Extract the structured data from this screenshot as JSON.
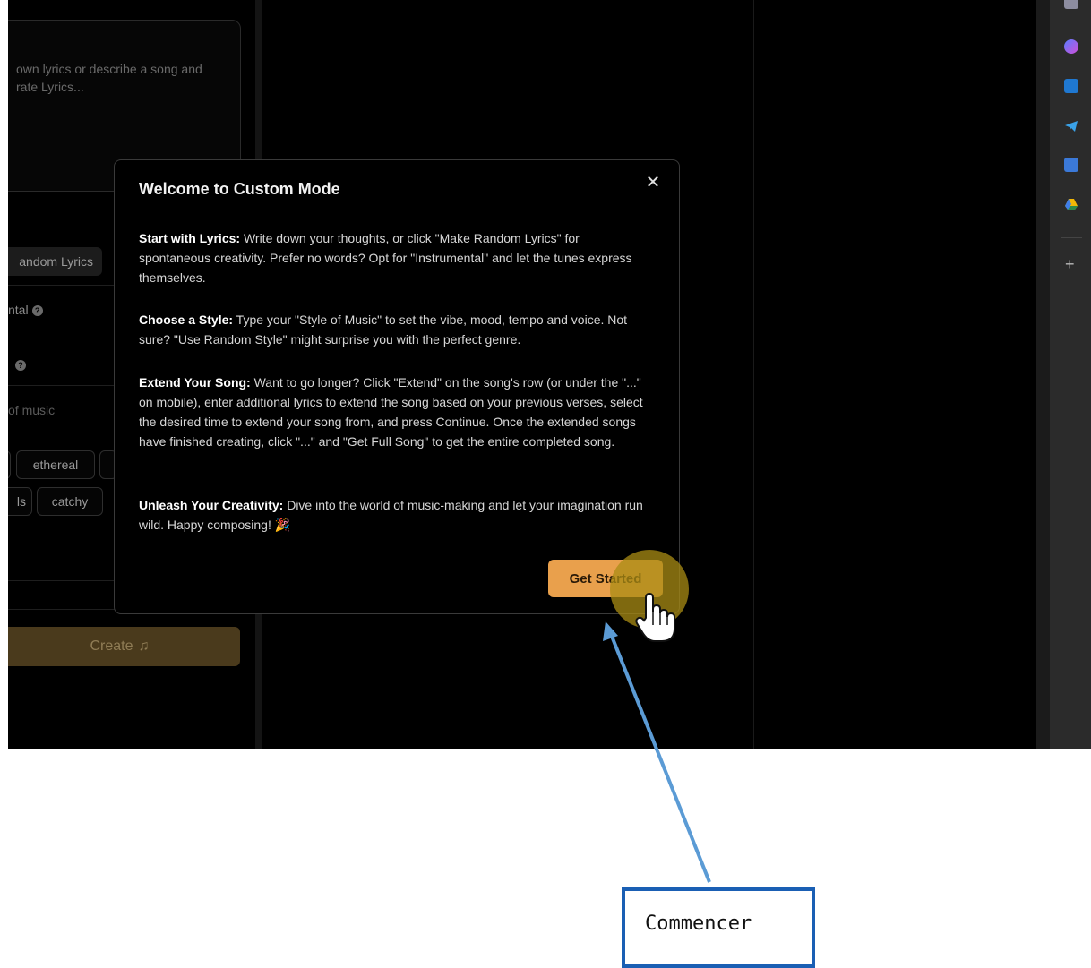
{
  "left_panel": {
    "lyrics_placeholder": "own lyrics or describe a song and\nrate Lyrics...",
    "random_lyrics_label": "andom Lyrics",
    "instrumental_label": "ntal",
    "style_placeholder": "of music",
    "chips": [
      "ethereal",
      "ls",
      "catchy"
    ],
    "create_label": "Create"
  },
  "modal": {
    "title": "Welcome to Custom Mode",
    "close_glyph": "✕",
    "sections": [
      {
        "heading": "Start with Lyrics:",
        "body": "Write down your thoughts, or click \"Make Random Lyrics\" for spontaneous creativity. Prefer no words? Opt for \"Instrumental\" and let the tunes express themselves."
      },
      {
        "heading": "Choose a Style:",
        "body": "Type your \"Style of Music\" to set the vibe, mood, tempo and voice. Not sure? \"Use Random Style\" might surprise you with the perfect genre."
      },
      {
        "heading": "Extend Your Song:",
        "body": "Want to go longer? Click \"Extend\" on the song's row (or under the \"...\" on mobile), enter additional lyrics to extend the song based on your previous verses, select the desired time to extend your song from, and press Continue. Once the extended songs have finished creating, click \"...\" and \"Get Full Song\" to get the entire completed song."
      },
      {
        "heading": "Unleash Your Creativity:",
        "body": "Dive into the world of music-making and let your imagination run wild. Happy composing! 🎉"
      }
    ],
    "get_started_label": "Get Started"
  },
  "annotation": {
    "label": "Commencer",
    "color": "#1a5fb4"
  },
  "colors": {
    "accent": "#e9a04c",
    "background": "#000000",
    "sidebar": "#2b2b2b"
  },
  "sidebar_icons": [
    "copilot-icon",
    "outlook-icon",
    "telegram-icon",
    "translate-icon",
    "drive-icon",
    "add-icon"
  ]
}
